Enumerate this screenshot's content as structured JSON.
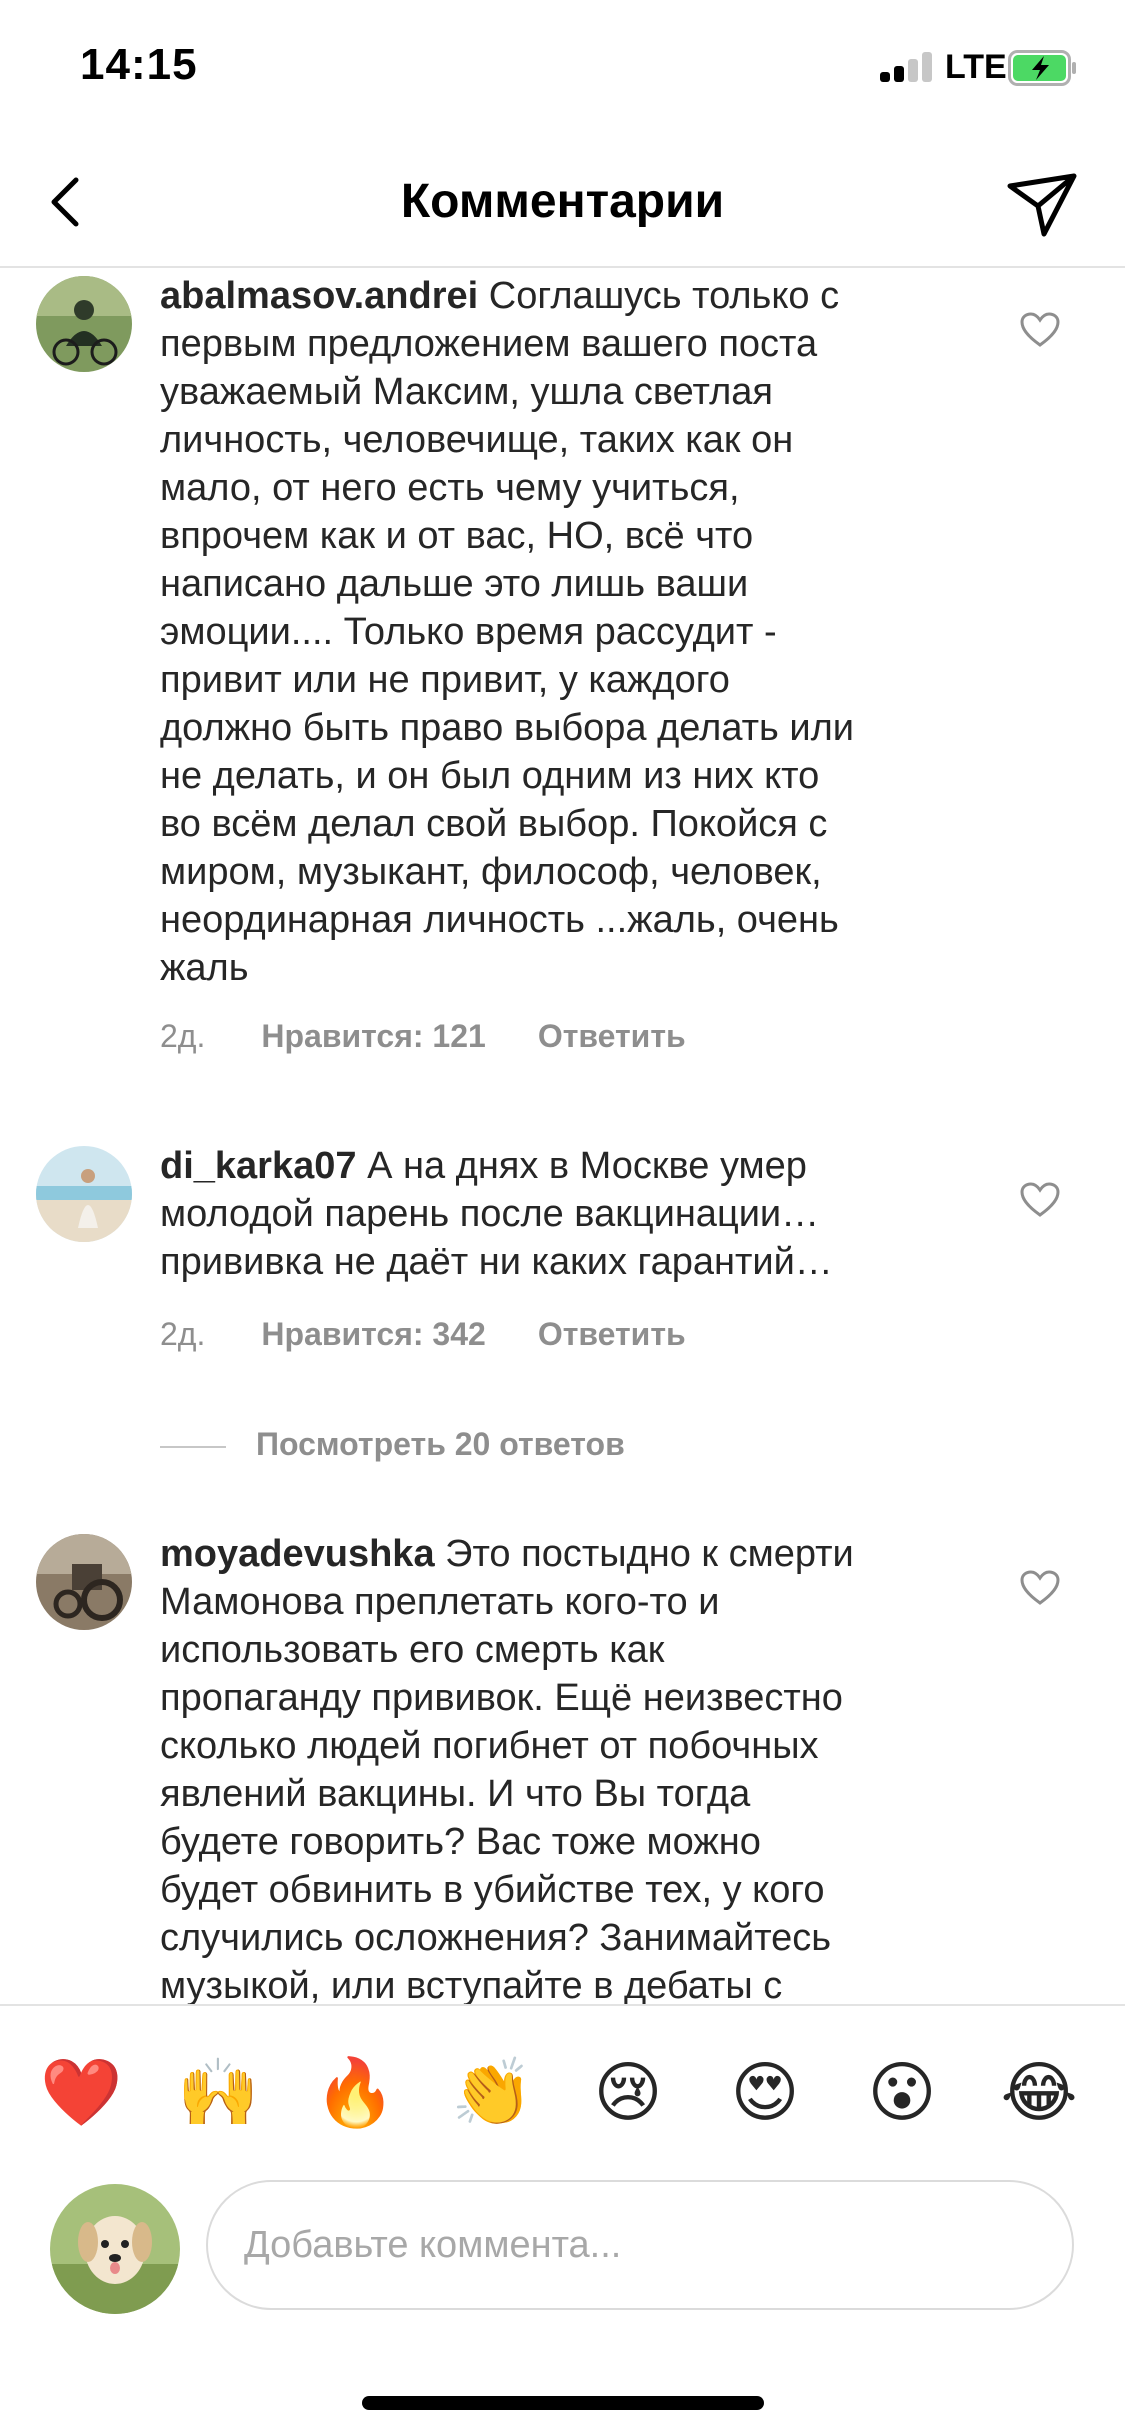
{
  "status_bar": {
    "time": "14:15",
    "network": "LTE"
  },
  "header": {
    "title": "Комментарии",
    "back_icon": "chevron-left-icon",
    "share_icon": "paper-plane-icon"
  },
  "comments": [
    {
      "username": "abalmasov.andrei",
      "text": "Соглашусь только с\nпервым предложением вашего поста\nуважаемый Максим, ушла светлая\nличность, человечище, таких как он\nмало,  от него есть чему учиться,\nвпрочем как и от вас, НО,  всё что\nнаписано дальше это лишь ваши\nэмоции.... Только время рассудит -\nпривит или не привит, у каждого\nдолжно быть право выбора делать или\nне делать, и он был одним из них кто\nво всём делал свой выбор.  Покойся с\nмиром, музыкант, философ, человек,\nнеординарная личность ...жаль, очень\nжаль",
      "time": "2д.",
      "likes": "Нравится: 121",
      "reply": "Ответить"
    },
    {
      "username": "di_karka07",
      "text": "А на днях в Москве умер\nмолодой парень после вакцинации…\nпрививка не даёт ни каких гарантий…",
      "time": "2д.",
      "likes": "Нравится: 342",
      "reply": "Ответить",
      "view_replies": "Посмотреть 20 ответов"
    },
    {
      "username": "moyadevushka",
      "text": "Это постыдно к смерти\nМамонова преплетать кого-то и\nиспользовать его смерть как\nпропаганду прививок. Ещё неизвестно\nсколько людей погибнет от побочных\nявлений вакцины. И что Вы тогда\nбудете говорить? Вас тоже можно\nбудет обвинить в убийстве тех, у кого\nслучились осложнения? Занимайтесь\nмузыкой, или вступайте в дебаты с"
    }
  ],
  "emoji_bar": [
    "❤️",
    "🙌",
    "🔥",
    "👏",
    "😢",
    "😍",
    "😮",
    "😂"
  ],
  "composer": {
    "placeholder": "Добавьте коммента..."
  },
  "colors": {
    "text": "#262626",
    "secondary": "#8e8e8e",
    "divider": "#e3e3e3",
    "battery": "#4cd964"
  }
}
